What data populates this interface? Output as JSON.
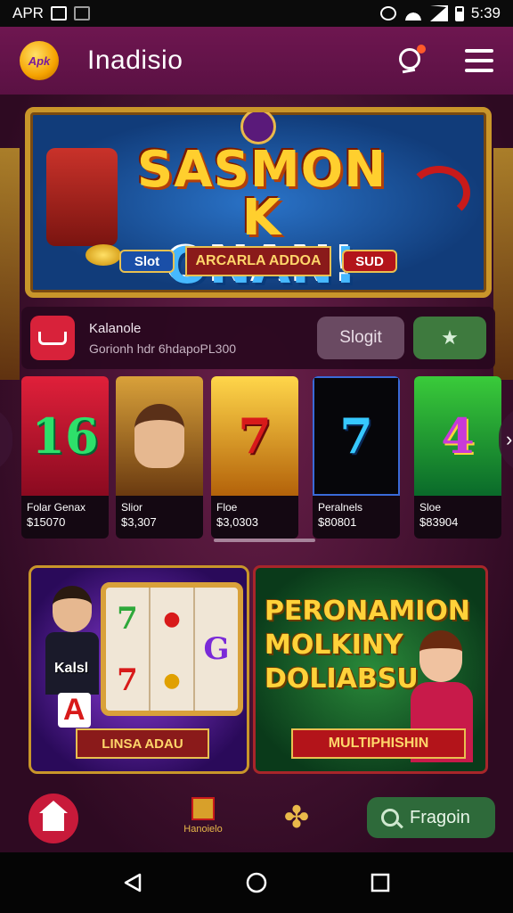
{
  "status_bar": {
    "left_text": "APR",
    "time": "5:39"
  },
  "header": {
    "logo_text": "Apk",
    "title": "Inadisio"
  },
  "hero": {
    "title_line1": "SASMON K",
    "title_line2": "ONAN!",
    "left_button": "Slot",
    "ribbon": "ARCARLA ADDOA",
    "right_button": "SUD"
  },
  "info_strip": {
    "title": "Kalanole",
    "subtitle": "Gorionh hdr 6hdapoPL300",
    "slot_button": "Slogit"
  },
  "cards": [
    {
      "symbol": "16",
      "name": "Folar Genax",
      "value": "$15070"
    },
    {
      "symbol": "",
      "name": "Slior",
      "value": "$3,307"
    },
    {
      "symbol": "7",
      "name": "Floe",
      "value": "$3,0303"
    },
    {
      "symbol": "7",
      "name": "Peralnels",
      "value": "$80801"
    },
    {
      "symbol": "4",
      "name": "Sloe",
      "value": "$83904"
    }
  ],
  "promo_left": {
    "badge": "Kalsl",
    "card": "A",
    "reels": [
      "7",
      "7",
      "G"
    ],
    "ribbon": "LINSA ADAU"
  },
  "promo_right": {
    "title": "PERONAMION MOLKINY DOLIABSU",
    "ribbon": "MULTIPHISHIN"
  },
  "bottom_nav": {
    "item2_label": "Hanoielo",
    "search_label": "Fragoin"
  },
  "colors": {
    "header_bg": "#6e1650",
    "accent_red": "#c81a3a",
    "accent_green": "#2e6a3a",
    "gold": "#c9962a"
  },
  "icons": {
    "header_search": "search-icon",
    "header_menu": "menu-icon",
    "home": "home-icon",
    "favorite": "star-icon",
    "clover": "clover-icon"
  }
}
